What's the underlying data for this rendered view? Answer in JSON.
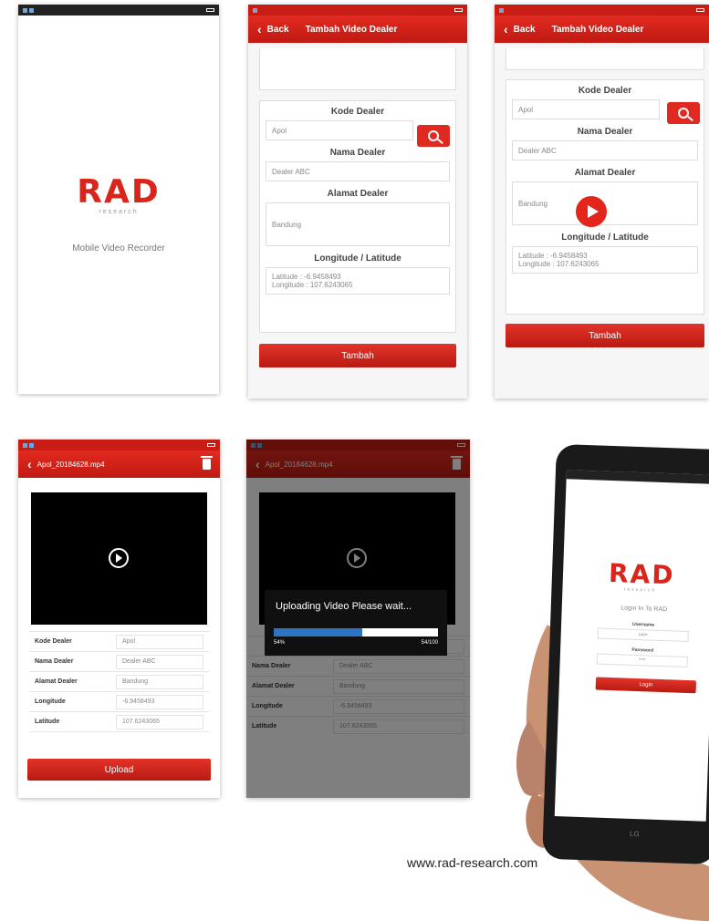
{
  "splash": {
    "logo": "RAD",
    "logo_sub": "research",
    "tagline": "Mobile Video Recorder"
  },
  "form_screen_1": {
    "appbar": {
      "back_label": "Back",
      "title": "Tambah Video Dealer"
    },
    "kode_dealer": {
      "title": "Kode Dealer",
      "value": "Apol"
    },
    "nama_dealer": {
      "title": "Nama Dealer",
      "value": "Dealer ABC"
    },
    "alamat_dealer": {
      "title": "Alamat Dealer",
      "value": "Bandung"
    },
    "location": {
      "title": "Longitude / Latitude",
      "latitude_line": "Latitude : -6.9458493",
      "longitude_line": "Longitude : 107.6243065"
    },
    "submit_label": "Tambah"
  },
  "form_screen_2": {
    "appbar": {
      "back_label": "Back",
      "title": "Tambah Video Dealer"
    },
    "kode_dealer": {
      "title": "Kode Dealer",
      "value": "Apol"
    },
    "nama_dealer": {
      "title": "Nama Dealer",
      "value": "Dealer ABC"
    },
    "alamat_dealer": {
      "title": "Alamat Dealer",
      "value": "Bandung"
    },
    "location": {
      "title": "Longitude / Latitude",
      "latitude_line": "Latitude : -6.9458493",
      "longitude_line": "Longitude : 107.6243065"
    },
    "submit_label": "Tambah"
  },
  "video_screen": {
    "appbar_title": "Apol_20184628.mp4",
    "rows": [
      {
        "key": "Kode Dealer",
        "value": "Apol"
      },
      {
        "key": "Nama Dealer",
        "value": "Dealer ABC"
      },
      {
        "key": "Alamat Dealer",
        "value": "Bandung"
      },
      {
        "key": "Longitude",
        "value": "-6.9458493"
      },
      {
        "key": "Latitude",
        "value": "107.6243065"
      }
    ],
    "upload_label": "Upload"
  },
  "upload_screen": {
    "appbar_title": "Apol_20184628.mp4",
    "dialog_title": "Uploading Video Please wait...",
    "progress_percent_label": "54%",
    "progress_count_label": "54/100",
    "progress_fraction": 0.54,
    "rows": [
      {
        "key": "Nama Dealer",
        "value": "Dealer ABC"
      },
      {
        "key": "Alamat Dealer",
        "value": "Bandung"
      },
      {
        "key": "Longitude",
        "value": "-6.9458493"
      },
      {
        "key": "Latitude",
        "value": "107.6243065"
      }
    ]
  },
  "login_screen": {
    "logo": "RAD",
    "logo_sub": "research",
    "heading": "Login In To RAD",
    "username_label": "Username",
    "username_value": "user",
    "password_label": "Password",
    "password_value": "****",
    "login_label": "Login",
    "brand": "LG"
  },
  "footer": {
    "url": "www.rad-research.com"
  },
  "colors": {
    "accent": "#d8261c",
    "appbar": "#c81d15",
    "progress": "#2e74c4"
  }
}
